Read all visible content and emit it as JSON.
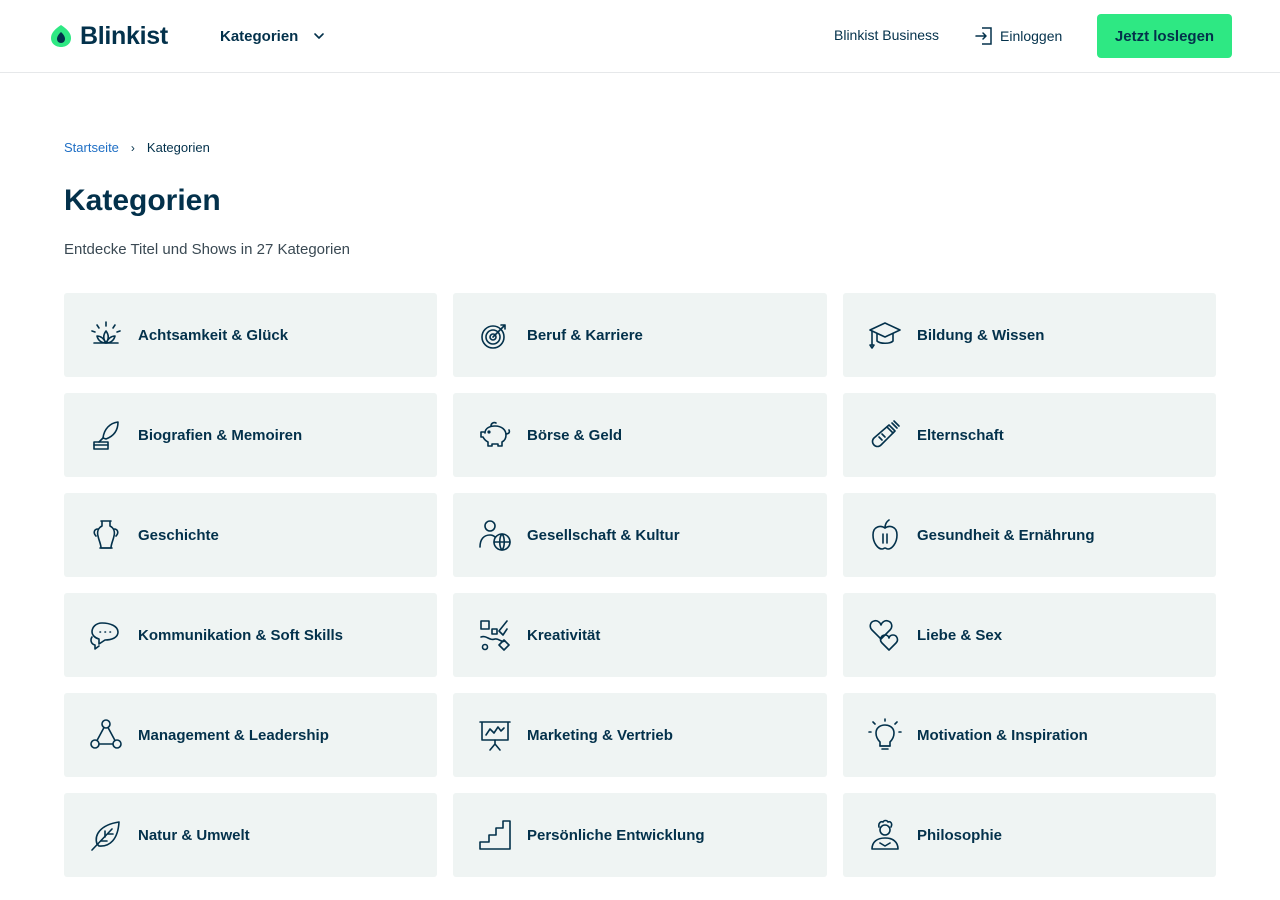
{
  "header": {
    "logo_text": "Blinkist",
    "nav_categories": "Kategorien",
    "nav_business": "Blinkist Business",
    "nav_login": "Einloggen",
    "cta": "Jetzt loslegen"
  },
  "breadcrumb": {
    "home": "Startseite",
    "current": "Kategorien"
  },
  "page": {
    "title": "Kategorien",
    "subtitle": "Entdecke Titel und Shows in 27 Kategorien"
  },
  "colors": {
    "brand_green": "#2ee883",
    "text_dark": "#03314b",
    "card_bg": "#eff4f3",
    "link_blue": "#1f6fc5"
  },
  "categories": [
    {
      "label": "Achtsamkeit & Glück",
      "icon": "lotus-icon"
    },
    {
      "label": "Beruf & Karriere",
      "icon": "target-icon"
    },
    {
      "label": "Bildung & Wissen",
      "icon": "graduation-cap-icon"
    },
    {
      "label": "Biografien & Memoiren",
      "icon": "quill-ink-icon"
    },
    {
      "label": "Börse & Geld",
      "icon": "piggy-bank-icon"
    },
    {
      "label": "Elternschaft",
      "icon": "baby-bottle-icon"
    },
    {
      "label": "Geschichte",
      "icon": "amphora-icon"
    },
    {
      "label": "Gesellschaft & Kultur",
      "icon": "person-globe-icon"
    },
    {
      "label": "Gesundheit & Ernährung",
      "icon": "apple-icon"
    },
    {
      "label": "Kommunikation & Soft Skills",
      "icon": "speech-bubbles-icon"
    },
    {
      "label": "Kreativität",
      "icon": "creative-shapes-icon"
    },
    {
      "label": "Liebe & Sex",
      "icon": "hearts-icon"
    },
    {
      "label": "Management & Leadership",
      "icon": "network-triangle-icon"
    },
    {
      "label": "Marketing & Vertrieb",
      "icon": "presentation-board-icon"
    },
    {
      "label": "Motivation & Inspiration",
      "icon": "lightbulb-icon"
    },
    {
      "label": "Natur & Umwelt",
      "icon": "leaf-icon"
    },
    {
      "label": "Persönliche Entwicklung",
      "icon": "stairs-icon"
    },
    {
      "label": "Philosophie",
      "icon": "thinker-icon"
    }
  ]
}
